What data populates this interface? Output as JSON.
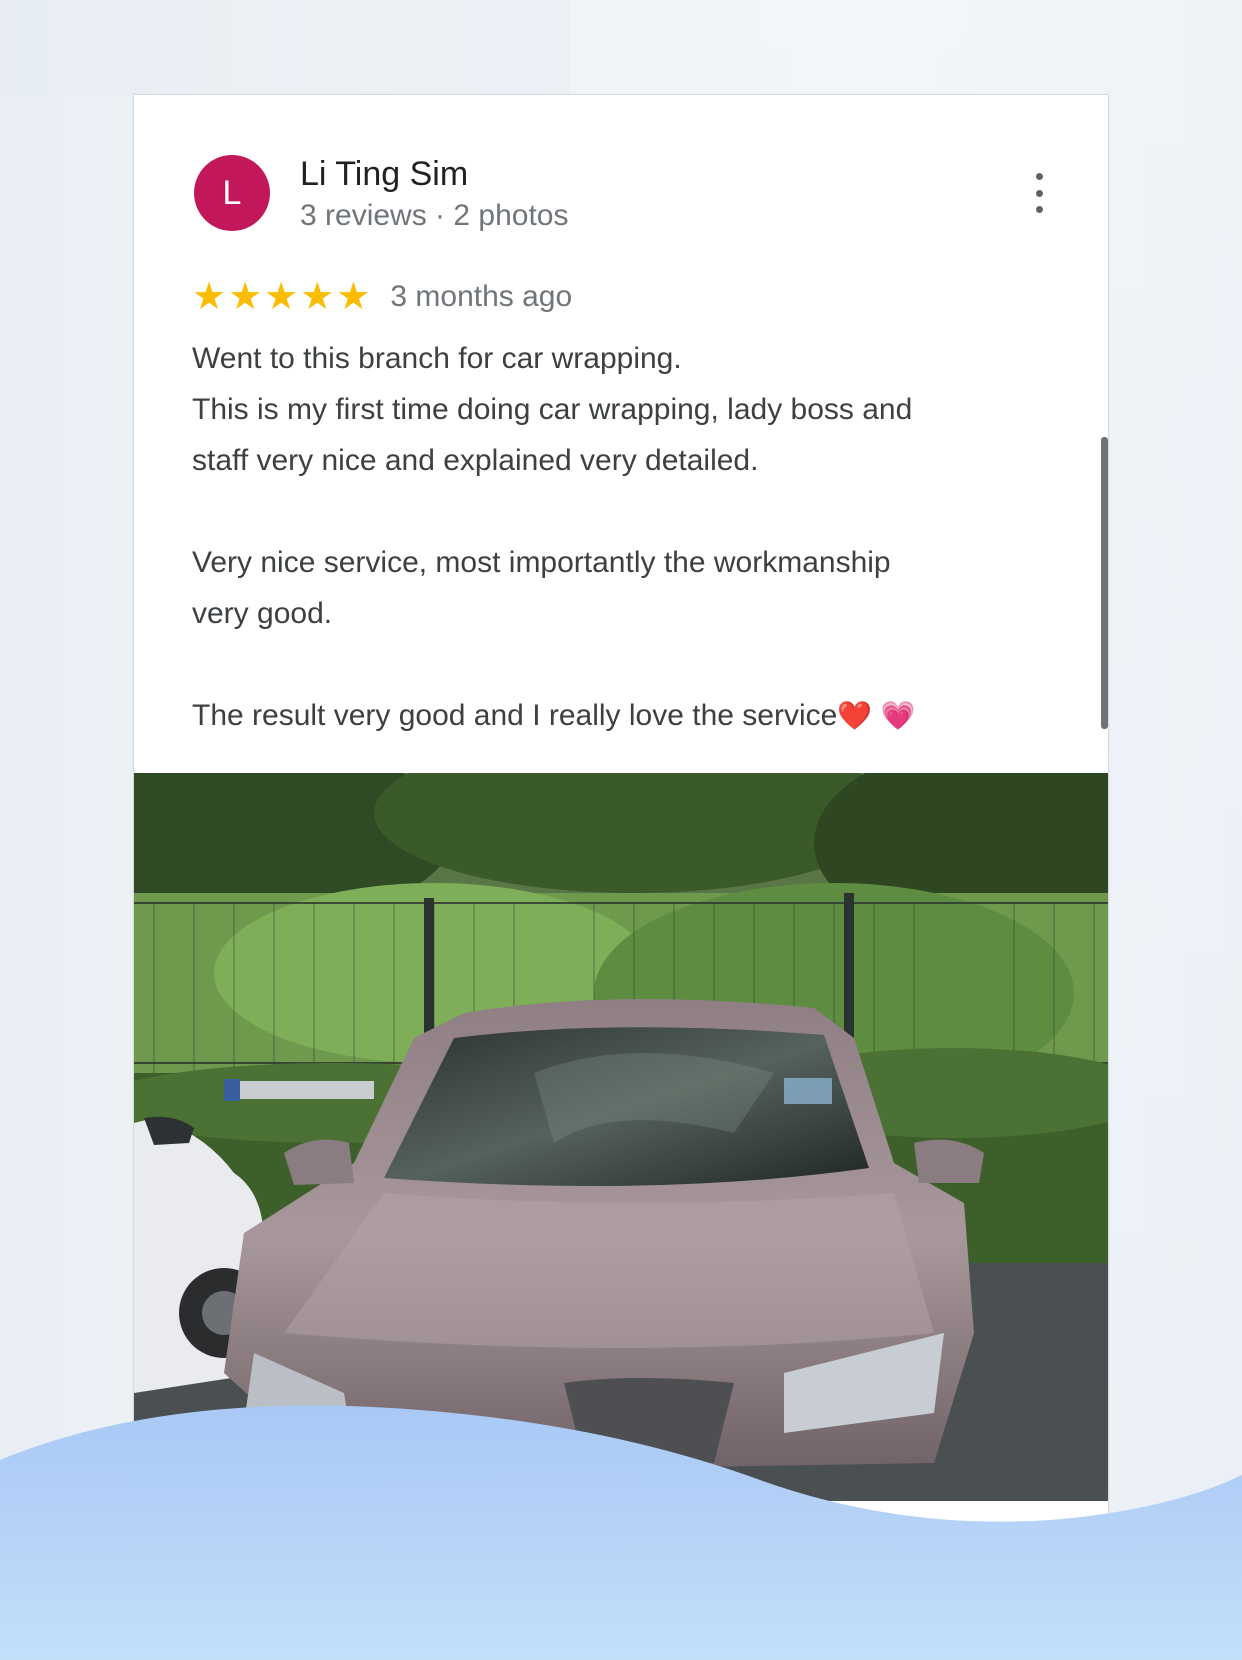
{
  "review": {
    "avatar_letter": "L",
    "avatar_color": "#c2185b",
    "author_name": "Li Ting Sim",
    "author_meta": "3 reviews · 2 photos",
    "rating": 5,
    "rating_max": 5,
    "time_ago": "3 months ago",
    "text_p1_l1": "Went to this branch for car wrapping.",
    "text_p1_l2": "This is my first time doing car wrapping, lady boss and",
    "text_p1_l3": "staff very nice and explained very detailed.",
    "text_p2_l1": "Very nice service, most importantly the workmanship",
    "text_p2_l2": "very good.",
    "text_p3": "The result very good and I really love the service",
    "emoji_1": "❤️",
    "emoji_2": "💗"
  },
  "colors": {
    "star": "#fbbc04",
    "accent_wave_top": "#a9c8f5",
    "accent_wave_bottom": "#bfdcf8"
  },
  "icons": [
    "more-vert-icon",
    "star-icon"
  ]
}
